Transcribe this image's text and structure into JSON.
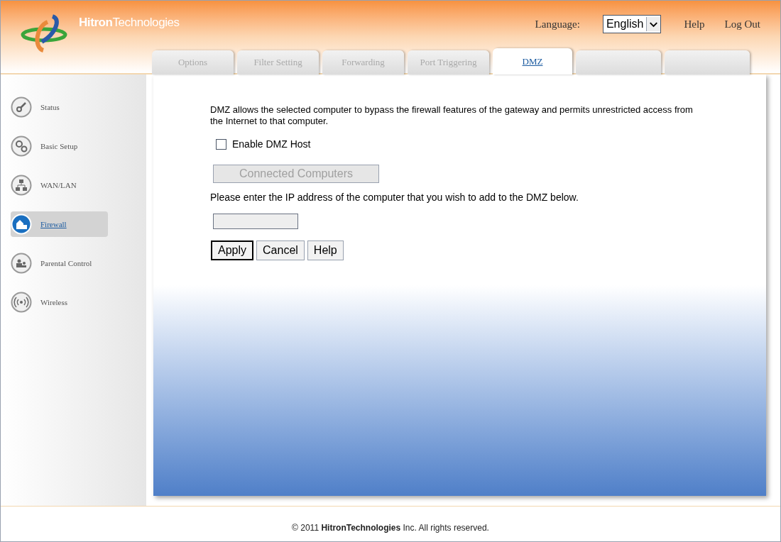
{
  "header": {
    "logo_text": "**Hitron**Technologies",
    "language_label": "Language:",
    "language_value": "English",
    "links": [
      "Help",
      "Log Out"
    ]
  },
  "tabs": [
    {
      "label": "Options",
      "selected": false
    },
    {
      "label": "Filter Setting",
      "selected": false
    },
    {
      "label": "Forwarding",
      "selected": false
    },
    {
      "label": "Port Triggering",
      "selected": false
    },
    {
      "label": "DMZ",
      "selected": true
    }
  ],
  "sidebar": {
    "items": [
      {
        "label": "Status",
        "kind": "key",
        "selected": false
      },
      {
        "label": "Basic Setup",
        "kind": "gears",
        "selected": false
      },
      {
        "label": "WAN/LAN",
        "kind": "network",
        "selected": false
      },
      {
        "label": "Firewall",
        "kind": "firewall",
        "selected": true
      },
      {
        "label": "Parental Control",
        "kind": "people",
        "selected": false
      },
      {
        "label": "Wireless",
        "kind": "wireless",
        "selected": false
      }
    ]
  },
  "content": {
    "description": "DMZ allows the selected computer to bypass the firewall features of the gateway and permits unrestricted access from the Internet to that computer.",
    "enable_dmz_host": {
      "label": "Enable DMZ Host",
      "checked": false
    },
    "connected_computers_button": {
      "label": "Connected Computers",
      "disabled": true
    },
    "ip_prompt": "Please enter the IP address of the computer that you wish to add to the DMZ below.",
    "ip_field": {
      "disabled": true
    },
    "buttons": [
      "Apply",
      "Cancel",
      "Help"
    ]
  },
  "footer": "© 2011 **HitronTechnologies** Inc.  All rights reserved."
}
